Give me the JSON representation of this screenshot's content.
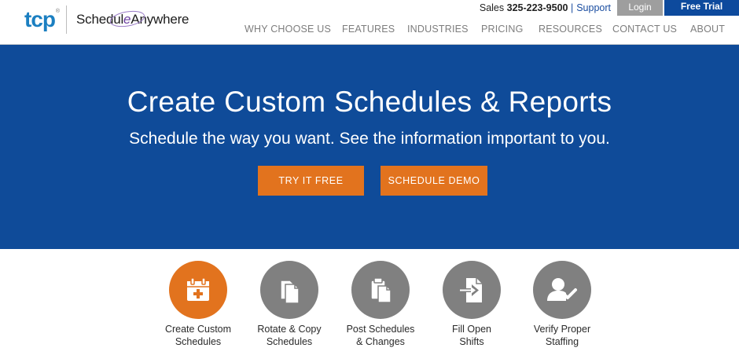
{
  "logo": {
    "tcp": "tcp",
    "tm": "®",
    "brand_pre": "Schedul",
    "brand_e": "e",
    "brand_post": "Anywhere"
  },
  "utility": {
    "sales_label": "Sales",
    "sales_phone": "325-223-9500",
    "separator": "|",
    "support": "Support",
    "login": "Login",
    "free_trial": "Free Trial"
  },
  "nav": [
    "WHY CHOOSE US",
    "FEATURES",
    "INDUSTRIES",
    "PRICING",
    "RESOURCES",
    "CONTACT US",
    "ABOUT"
  ],
  "hero": {
    "title": "Create Custom Schedules & Reports",
    "subtitle": "Schedule the way you want. See the information important to you.",
    "try_free": "TRY IT FREE",
    "schedule_demo": "SCHEDULE DEMO"
  },
  "features": [
    {
      "line1": "Create Custom",
      "line2": "Schedules",
      "icon": "calendar-plus-icon",
      "active": true
    },
    {
      "line1": "Rotate & Copy",
      "line2": "Schedules",
      "icon": "copy-documents-icon",
      "active": false
    },
    {
      "line1": "Post Schedules",
      "line2": "& Changes",
      "icon": "clipboard-post-icon",
      "active": false
    },
    {
      "line1": "Fill Open",
      "line2": "Shifts",
      "icon": "document-arrow-icon",
      "active": false
    },
    {
      "line1": "Verify Proper",
      "line2": "Staffing",
      "icon": "user-check-icon",
      "active": false
    }
  ],
  "colors": {
    "hero_bg": "#0f4b99",
    "accent_orange": "#e2731e",
    "trial_blue": "#0d4a9d",
    "login_gray": "#9e9e9e",
    "icon_gray": "#808080"
  }
}
